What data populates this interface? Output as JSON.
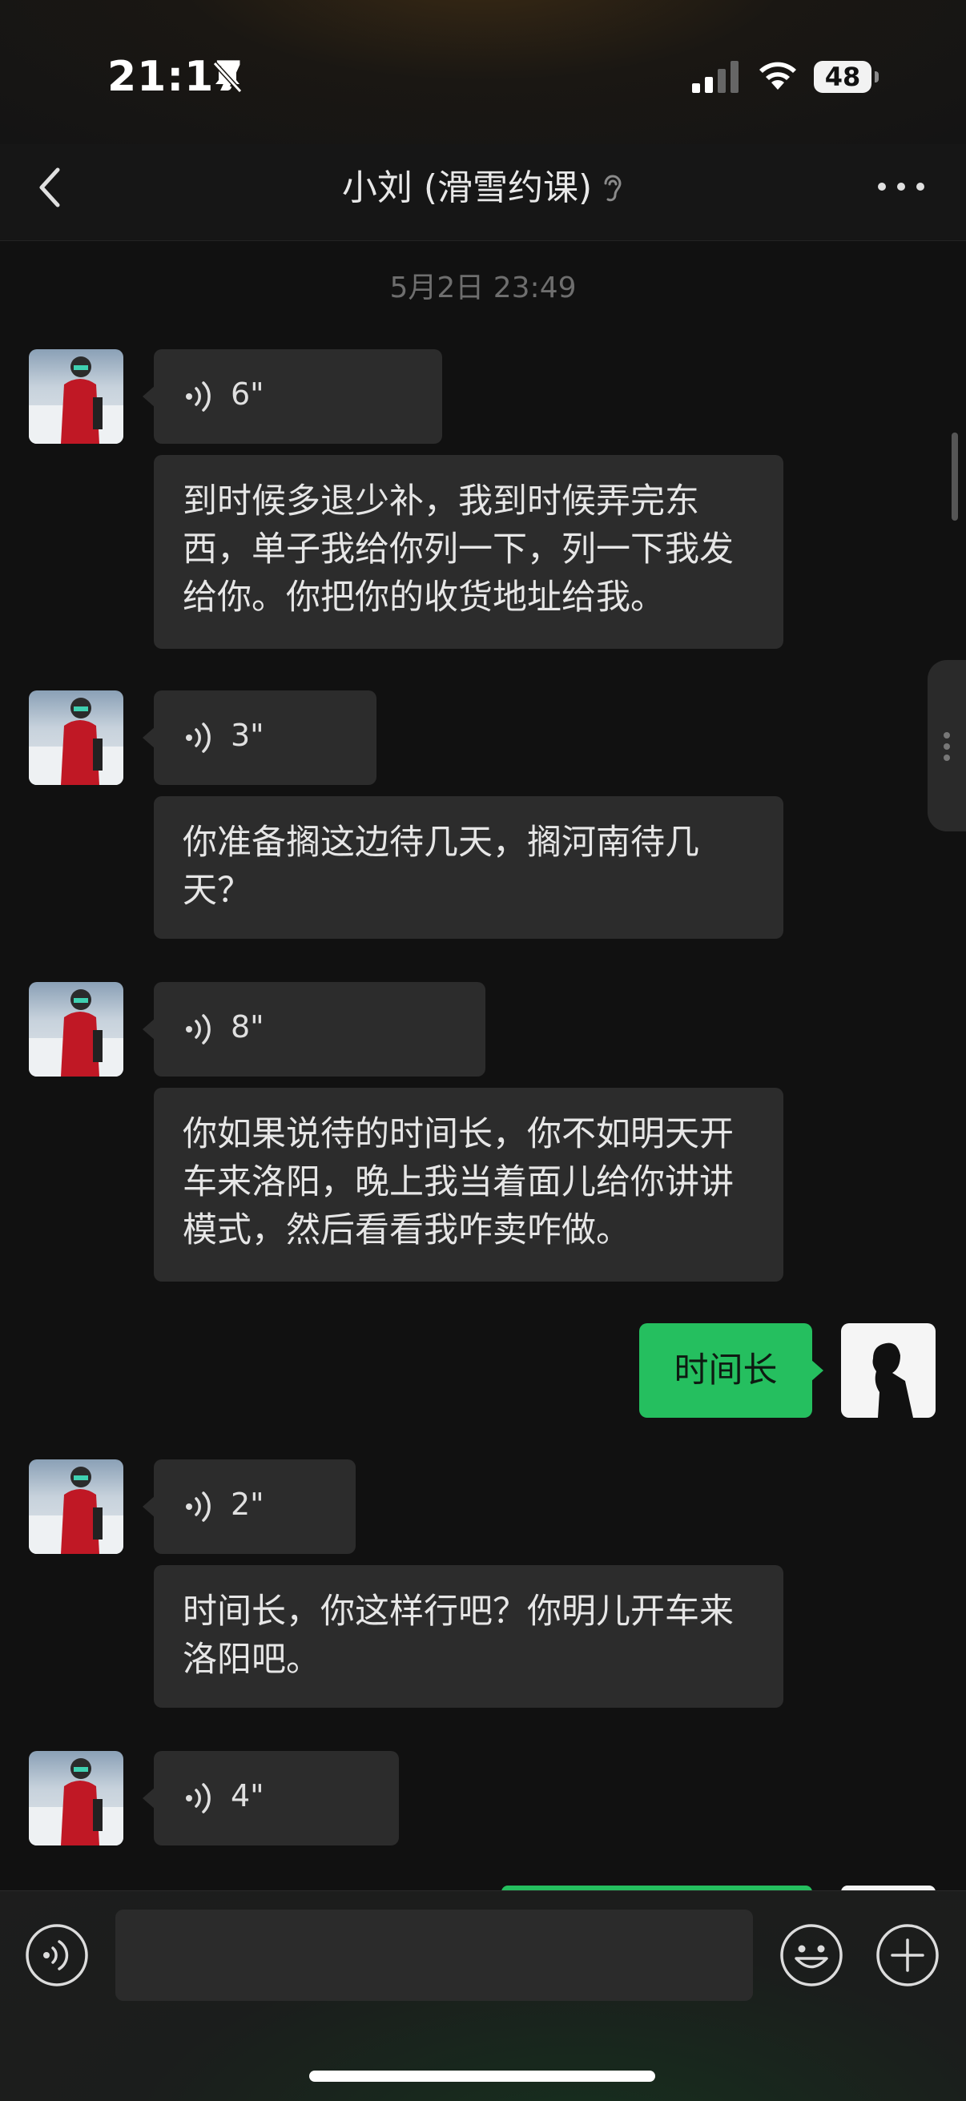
{
  "status_bar": {
    "time": "21:17",
    "battery": "48"
  },
  "header": {
    "title": "小刘 (滑雪约课)"
  },
  "chat": {
    "date": "5月2日 23:49",
    "messages": [
      {
        "type": "voice",
        "duration": "6\""
      },
      {
        "type": "text",
        "text": "到时候多退少补，我到时候弄完东西，单子我给你列一下，列一下我发给你。你把你的收货地址给我。"
      },
      {
        "type": "voice",
        "duration": "3\""
      },
      {
        "type": "text",
        "text": "你准备搁这边待几天，搁河南待几天？"
      },
      {
        "type": "voice",
        "duration": "8\""
      },
      {
        "type": "text",
        "text": "你如果说待的时间长，你不如明天开车来洛阳，晚上我当着面儿给你讲讲模式，然后看看我咋卖咋做。"
      },
      {
        "type": "sent",
        "text": "时间长"
      },
      {
        "type": "voice",
        "duration": "2\""
      },
      {
        "type": "text",
        "text": "时间长，你这样行吧？你明儿开车来洛阳吧。"
      },
      {
        "type": "voice",
        "duration": "4\""
      }
    ]
  },
  "input_bar": {
    "placeholder": ""
  },
  "colors": {
    "accent_green": "#25bf5f",
    "bubble_bg": "#2c2c2c",
    "background": "#111111"
  }
}
